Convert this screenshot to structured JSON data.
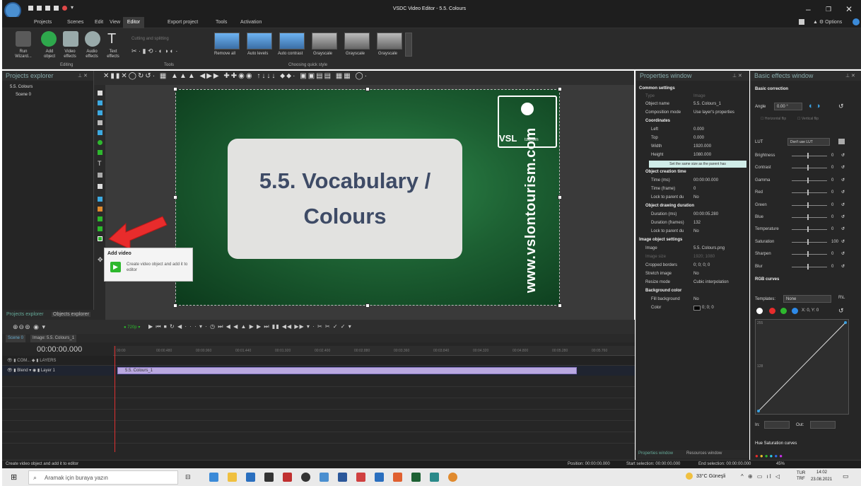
{
  "window": {
    "title": "VSDC Video Editor - 5.5. Colours",
    "options_label": "Options"
  },
  "menu": [
    "Projects",
    "Scenes",
    "Edit",
    "View",
    "Editor",
    "Export project",
    "Tools",
    "Activation"
  ],
  "ribbon": {
    "buttons": [
      {
        "label": "Run\nWizard..."
      },
      {
        "label": "Add\nobject"
      },
      {
        "label": "Video\neffects"
      },
      {
        "label": "Audio\neffects"
      },
      {
        "label": "Text\neffects"
      }
    ],
    "editing_group": "Editing",
    "tools_group": "Tools",
    "cutting_label": "Cutting and splitting",
    "quick_styles": [
      "Remove all",
      "Auto levels",
      "Auto contrast",
      "Grayscale",
      "Grayscale",
      "Grayscale"
    ],
    "quick_style_group": "Choosing quick style"
  },
  "projects_explorer": {
    "title": "Projects explorer",
    "items": [
      "5.5. Colours",
      "Scene 0"
    ],
    "tabs": [
      "Projects explorer",
      "Objects explorer"
    ]
  },
  "canvas": {
    "vocab_line1": "5.5. Vocabulary /",
    "vocab_line2": "Colours",
    "logo_text": "VSL",
    "logo_small": "tourism",
    "site": "www.vslontourism.com"
  },
  "tooltip": {
    "title": "Add video",
    "description": "Create video object and add it to editor"
  },
  "properties": {
    "title": "Properties window",
    "common": "Common settings",
    "type_label": "Type",
    "type_value": "Image",
    "name_label": "Object name",
    "name_value": "5.5. Colours_1",
    "comp_label": "Composition mode",
    "comp_value": "Use layer's properties",
    "coords": "Coordinates",
    "left_label": "Left",
    "left_value": "0.000",
    "top_label": "Top",
    "top_value": "0.000",
    "width_label": "Width",
    "width_value": "1920.000",
    "height_label": "Height",
    "height_value": "1080.000",
    "same_size": "Set the same size as the parent has",
    "creation": "Object creation time",
    "time_ms_label": "Time (ms)",
    "time_ms_value": "00:00:00.000",
    "time_frame_label": "Time (frame)",
    "time_frame_value": "0",
    "lock1_label": "Lock to parent du",
    "lock1_value": "No",
    "drawing": "Object drawing duration",
    "dur_ms_label": "Duration (ms)",
    "dur_ms_value": "00:00:05.280",
    "dur_fr_label": "Duration (frames)",
    "dur_fr_value": "132",
    "lock2_label": "Lock to parent du",
    "lock2_value": "No",
    "image_obj": "Image object settings",
    "image_label": "Image",
    "image_value": "5.5. Colours.png",
    "imgsize_label": "Image size",
    "imgsize_value": "1920; 1080",
    "crop_label": "Cropped borders",
    "crop_value": "0; 0; 0; 0",
    "stretch_label": "Stretch image",
    "stretch_value": "No",
    "resize_label": "Resize mode",
    "resize_value": "Cubic interpolation",
    "bg": "Background color",
    "fill_label": "Fill background",
    "fill_value": "No",
    "color_label": "Color",
    "color_value": "0; 0; 0",
    "tabs": [
      "Properties window",
      "Resources window"
    ]
  },
  "effects": {
    "title": "Basic effects window",
    "basic": "Basic correction",
    "angle_label": "Angle",
    "angle_value": "0.00 °",
    "hflip": "Horizontal flip",
    "vflip": "Vertical flip",
    "lut_label": "LUT",
    "lut_value": "Don't use LUT",
    "sliders": [
      {
        "name": "Brightness",
        "value": "0"
      },
      {
        "name": "Contrast",
        "value": "0"
      },
      {
        "name": "Gamma",
        "value": "0"
      },
      {
        "name": "Red",
        "value": "0"
      },
      {
        "name": "Green",
        "value": "0"
      },
      {
        "name": "Blue",
        "value": "0"
      },
      {
        "name": "Temperature",
        "value": "0"
      },
      {
        "name": "Saturation",
        "value": "100"
      },
      {
        "name": "Sharpen",
        "value": "0"
      },
      {
        "name": "Blur",
        "value": "0"
      }
    ],
    "rgb": "RGB curves",
    "templates_label": "Templates:",
    "templates_value": "None",
    "xy": "X: 0, Y: 0",
    "curve_top": "255",
    "curve_mid": "128",
    "in_label": "In:",
    "out_label": "Out:",
    "hue": "Hue Saturation curves"
  },
  "timeline": {
    "resolution": "720p",
    "tabs": [
      "Scene 0",
      "Image: 5.5. Colours_1"
    ],
    "timecode": "00:00:00.000",
    "ticks": [
      "00:00",
      "00:00.480",
      "00:00.960",
      "00:01.440",
      "00:01.920",
      "00:02.400",
      "00:02.880",
      "00:03.360",
      "00:03.840",
      "00:04.320",
      "00:04.800",
      "00:05.280",
      "00:05.760"
    ],
    "track1": {
      "label": "COM...",
      "layers": "LAYERS"
    },
    "track2": {
      "blend": "Blend",
      "layer": "Layer 1"
    },
    "clip": "5.5. Colours_1"
  },
  "status": {
    "left": "Create video object and add it to editor",
    "position": "Position:  00:00:00.000",
    "start_sel": "Start selection:  00:00:00.000",
    "end_sel": "End selection:  00:00:00.000",
    "zoom": "45%"
  },
  "taskbar": {
    "search": "Aramak için buraya yazın",
    "weather": "33°C  Güneşli",
    "lang": "TUR\nTRF",
    "time": "14:02",
    "date": "23.08.2021"
  }
}
